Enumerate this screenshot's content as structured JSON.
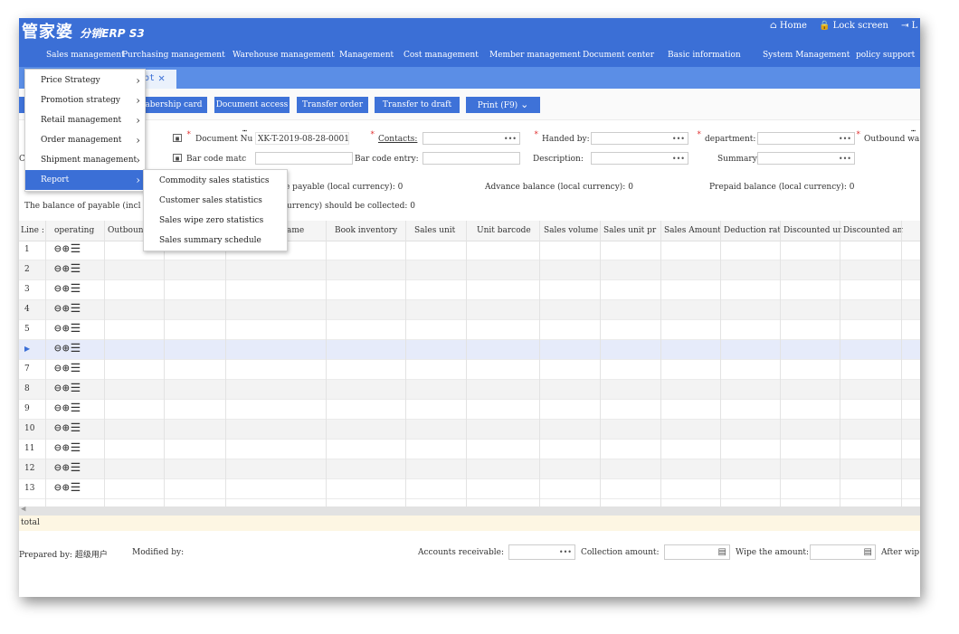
{
  "header": {
    "brand": "管家婆",
    "brand_sub": "分销ERP S3",
    "home": "Home",
    "lock": "Lock screen",
    "exit_fragment": "L"
  },
  "menubar": [
    "Sales management",
    "Purchasing management",
    "Warehouse management",
    "Management",
    "Cost management",
    "Member management",
    "Document center",
    "Basic information",
    "System Management",
    "policy support"
  ],
  "tab": {
    "label": "pt",
    "close": "✕"
  },
  "toolbar": {
    "membership_card": "abership card",
    "document_access": "Document access",
    "transfer_order": "Transfer order",
    "transfer_draft": "Transfer to draft",
    "print": "Print (F9)"
  },
  "form": {
    "document_no_label": "Document Nu",
    "document_no_value": "XK-T-2019-08-28-0001",
    "contacts_label": "Contacts:",
    "handed_by_label": "Handed by:",
    "department_label": "department:",
    "outbound_label": "Outbound wa",
    "barcode_match_label": "Bar code matc",
    "barcode_entry_label": "Bar code entry:",
    "description_label": "Description:",
    "summary_label": "Summary:",
    "c_fragment": "C",
    "payable_label": "e payable (local currency):",
    "payable_value": "0",
    "advance_label": "Advance balance (local currency):",
    "advance_value": "0",
    "prepaid_label": "Prepaid balance (local currency):",
    "prepaid_value": "0",
    "balance_label": "The balance of payable (incl",
    "collected_label": "urrency) should be collected:",
    "collected_value": "0"
  },
  "table": {
    "headers": [
      "Line :",
      "operating",
      "Outbound",
      "ame",
      "Book inventory",
      "Sales unit",
      "Unit barcode",
      "Sales volume",
      "Sales unit pr",
      "Sales Amount",
      "Deduction rat",
      "Discounted un",
      "Discounted am"
    ],
    "rows": [
      "1",
      "2",
      "3",
      "4",
      "5",
      "▶",
      "7",
      "8",
      "9",
      "10",
      "11",
      "12",
      "13"
    ],
    "ops": "⊖⊕☰",
    "total_label": "total"
  },
  "footer": {
    "prepared_by_label": "Prepared by:",
    "prepared_by_value": "超级用户",
    "modified_by_label": "Modified by:",
    "accounts_receivable_label": "Accounts receivable:",
    "collection_amount_label": "Collection amount:",
    "wipe_amount_label": "Wipe the amount:",
    "after_wipe_label": "After wip"
  },
  "dropdown": {
    "items": [
      "Price Strategy",
      "Promotion strategy",
      "Retail management",
      "Order management",
      "Shipment management",
      "Report"
    ],
    "active": "Report",
    "sub_items": [
      "Commodity sales statistics",
      "Customer sales statistics",
      "Sales wipe zero statistics",
      "Sales summary schedule"
    ]
  },
  "colors": {
    "primary": "#3b6fd6",
    "tabbar": "#5b8ee6",
    "button": "#3e72d8",
    "required": "#e03030"
  }
}
